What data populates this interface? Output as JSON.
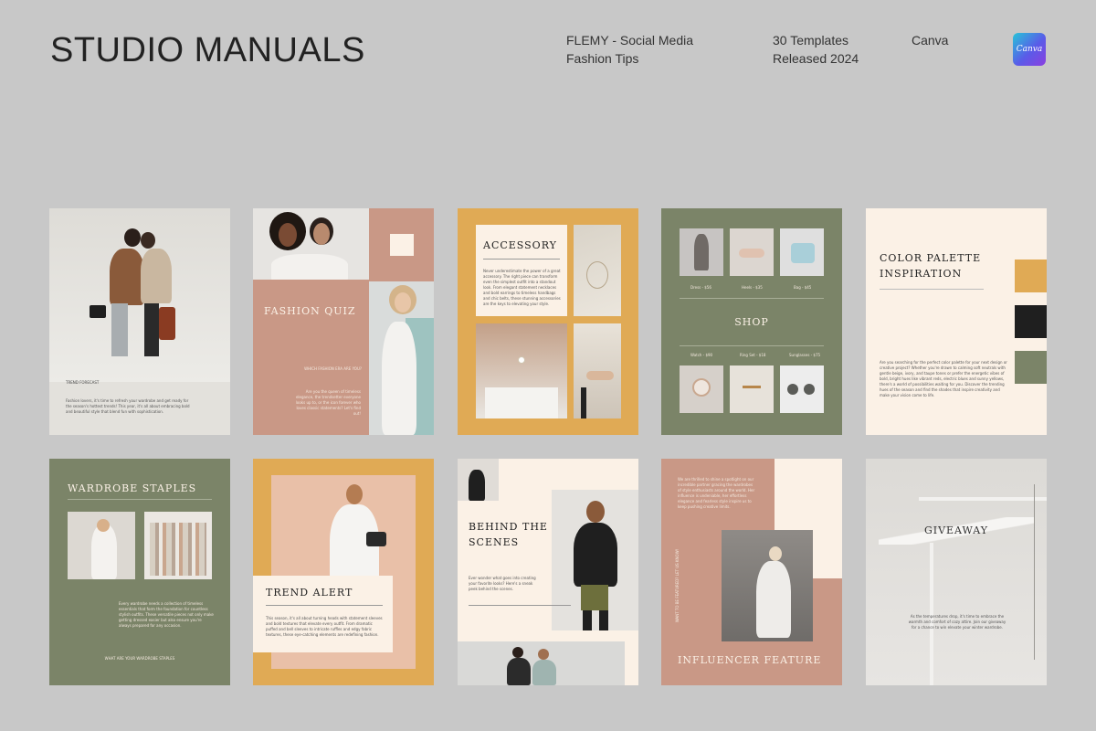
{
  "header": {
    "brand": "STUDIO MANUALS",
    "product_line1": "FLEMY - Social Media",
    "product_line2": "Fashion Tips",
    "count": "30 Templates",
    "released": "Released 2024",
    "platform": "Canva",
    "logo_text": "Canva"
  },
  "colors": {
    "background": "#c8c8c8",
    "terracotta": "#c99886",
    "mustard": "#e0aa55",
    "sage": "#7b8468",
    "cream": "#fbf1e6",
    "black": "#1f1f1f"
  },
  "cards": {
    "trend_forecast": {
      "label": "TREND FORECAST",
      "body": "Fashion lovers, it's time to refresh your wardrobe and get ready for the season's hottest trends! This year, it's all about embracing bold and beautiful style that blend fun with sophistication."
    },
    "fashion_quiz": {
      "title": "FASHION QUIZ",
      "sub": "WHICH FASHION ERA ARE YOU?",
      "body": "Are you the queen of timeless elegance, the trendsetter everyone looks up to, or the icon forever who loves classic statements? Let's find out!"
    },
    "accessory": {
      "title": "ACCESSORY",
      "body": "Never underestimate the power of a great accessory. The right piece can transform even the simplest outfit into a standout look. From elegant statement necklaces and bold earrings to timeless handbags and chic belts, these stunning accessories are the keys to elevating your style."
    },
    "shop": {
      "title": "SHOP",
      "items_top": [
        "Dress - $56",
        "Heels - $35",
        "Bag - $45"
      ],
      "items_bottom": [
        "Watch - $90",
        "Ring Set - $18",
        "Sunglasses - $75"
      ]
    },
    "color_palette": {
      "title_line1": "COLOR PALETTE",
      "title_line2": "INSPIRATION",
      "body": "Are you searching for the perfect color palette for your next design or creative project? Whether you're drawn to calming soft neutrals with gentle beige, ivory, and taupe tones or prefer the energetic vibes of bold, bright hues like vibrant reds, electric blues and sunny yellows, there's a world of possibilities waiting for you. Discover the trending hues of the season and find the shades that inspire creativity and make your vision come to life."
    },
    "wardrobe_staples": {
      "title": "WARDROBE STAPLES",
      "body": "Every wardrobe needs a collection of timeless essentials that form the foundation for countless stylish outfits. These versatile pieces not only make getting dressed easier but also ensure you're always prepared for any occasion.",
      "footer": "WHAT ARE YOUR WARDROBE STAPLES"
    },
    "trend_alert": {
      "title": "TREND ALERT",
      "body": "This season, it's all about turning heads with statement sleeves and bold textures that elevate every outfit. From dramatic puffed and bell sleeves to intricate ruffles and edgy fabric textures, these eye-catching elements are redefining fashion."
    },
    "behind_scenes": {
      "title_line1": "BEHIND THE",
      "title_line2": "SCENES",
      "body": "Ever wonder what goes into creating your favorite looks? Here's a sneak peek behind the scenes."
    },
    "influencer": {
      "title": "INFLUENCER FEATURE",
      "side": "WANT TO BE FEATURED? LET US KNOW!",
      "body": "We are thrilled to shine a spotlight on our incredible partner gracing the wardrobes of style enthusiasts around the world. Her influence is undeniable, her effortless elegance and fearless style inspire us to keep pushing creative limits."
    },
    "giveaway": {
      "title": "GIVEAWAY",
      "body": "As the temperatures drop, it's time to embrace the warmth and comfort of cozy attire. Join our giveaway for a chance to win elevate your winter wardrobe."
    }
  }
}
